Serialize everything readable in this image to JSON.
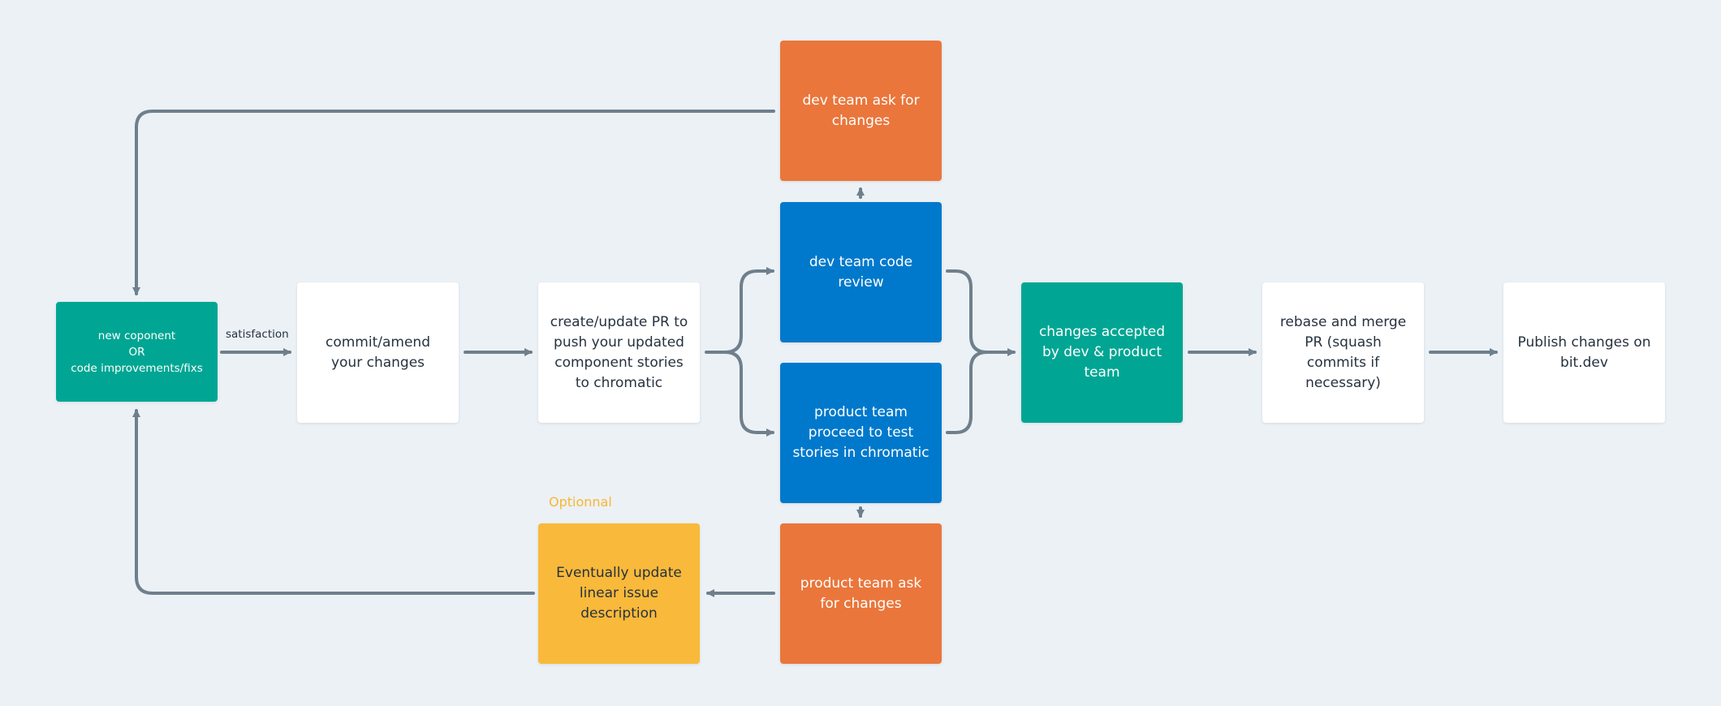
{
  "colors": {
    "background": "#ecf1f5",
    "teal": "#00a693",
    "blue": "#0079cc",
    "orange": "#ea763b",
    "yellow": "#f9b93a",
    "white": "#ffffff",
    "connector": "#6e7f8d",
    "dark_text": "#26323f",
    "optional_label": "#f7b733"
  },
  "nodes": {
    "start": {
      "label": "new coponent\nOR\ncode improvements/fixs",
      "color": "teal"
    },
    "commit": {
      "label": "commit/amend your changes",
      "color": "white"
    },
    "create_pr": {
      "label": "create/update PR to push your updated component stories to chromatic",
      "color": "white"
    },
    "dev_ask": {
      "label": "dev team ask for changes",
      "color": "orange"
    },
    "dev_review": {
      "label": "dev team code review",
      "color": "blue"
    },
    "product_test": {
      "label": "product team proceed to test stories in chromatic",
      "color": "blue"
    },
    "product_ask": {
      "label": "product team ask for changes",
      "color": "orange"
    },
    "linear_update": {
      "label": "Eventually update linear issue description",
      "color": "yellow"
    },
    "accepted": {
      "label": "changes accepted by dev & product team",
      "color": "teal"
    },
    "rebase_merge": {
      "label": "rebase and merge PR (squash commits if necessary)",
      "color": "white"
    },
    "publish": {
      "label": "Publish changes on bit.dev",
      "color": "white"
    }
  },
  "labels": {
    "satisfaction": "satisfaction",
    "optional": "Optionnal"
  },
  "edges": [
    {
      "from": "start",
      "to": "commit",
      "label": "satisfaction"
    },
    {
      "from": "commit",
      "to": "create_pr"
    },
    {
      "from": "create_pr",
      "to": "dev_review"
    },
    {
      "from": "create_pr",
      "to": "product_test"
    },
    {
      "from": "dev_review",
      "to": "dev_ask"
    },
    {
      "from": "product_test",
      "to": "product_ask"
    },
    {
      "from": "dev_ask",
      "to": "start"
    },
    {
      "from": "product_ask",
      "to": "linear_update"
    },
    {
      "from": "linear_update",
      "to": "start"
    },
    {
      "from": "dev_review",
      "to": "accepted"
    },
    {
      "from": "product_test",
      "to": "accepted"
    },
    {
      "from": "accepted",
      "to": "rebase_merge"
    },
    {
      "from": "rebase_merge",
      "to": "publish"
    }
  ]
}
